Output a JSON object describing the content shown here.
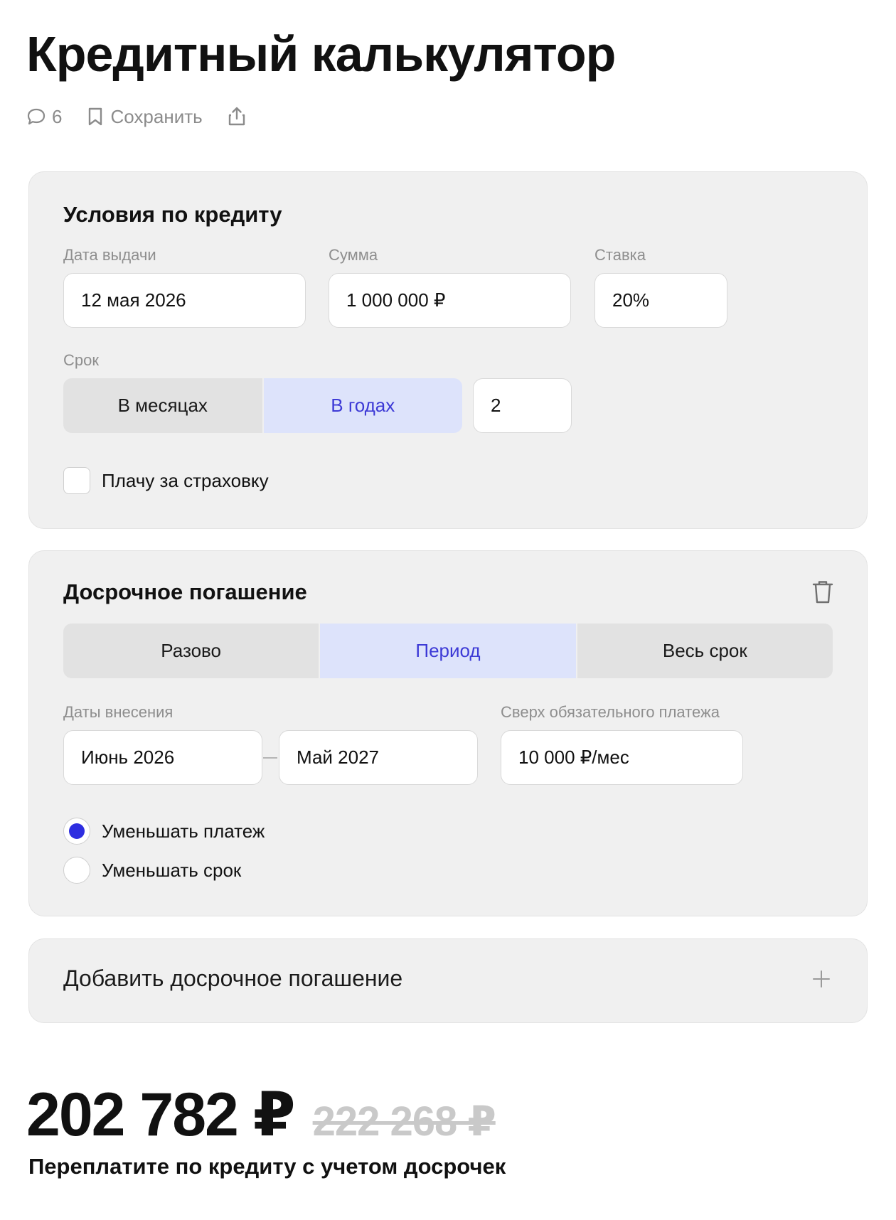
{
  "page": {
    "title": "Кредитный калькулятор"
  },
  "meta": {
    "comments_count": "6",
    "save_label": "Сохранить"
  },
  "conditions": {
    "title": "Условия по кредиту",
    "issue_date_label": "Дата выдачи",
    "issue_date_value": "12 мая 2026",
    "amount_label": "Сумма",
    "amount_value": "1 000 000 ₽",
    "rate_label": "Ставка",
    "rate_value": "20%",
    "term_label": "Срок",
    "term_options": [
      "В месяцах",
      "В годах"
    ],
    "term_selected": "В годах",
    "term_value": "2",
    "insurance_label": "Плачу за страховку",
    "insurance_checked": false
  },
  "early": {
    "title": "Досрочное погашение",
    "mode_options": [
      "Разово",
      "Период",
      "Весь срок"
    ],
    "mode_selected": "Период",
    "dates_label": "Даты внесения",
    "date_from": "Июнь 2026",
    "date_to": "Май 2027",
    "extra_label": "Сверх обязательного платежа",
    "extra_value": "10 000 ₽/мес",
    "options": [
      "Уменьшать платеж",
      "Уменьшать срок"
    ],
    "option_selected": "Уменьшать платеж"
  },
  "add": {
    "label": "Добавить досрочное погашение"
  },
  "result": {
    "overpay": "202 782 ₽",
    "overpay_without_early": "222 268 ₽",
    "caption": "Переплатите по кредиту с учетом досрочек"
  },
  "colors": {
    "accent": "#2e2ee0",
    "active_segment_bg": "#dde3fb",
    "active_segment_text": "#3d3ad6",
    "card_bg": "#f0f0f0"
  },
  "icons": {
    "comments": "comment-bubble-icon",
    "save": "bookmark-icon",
    "share": "share-icon",
    "delete": "trash-icon",
    "add": "plus-icon"
  }
}
